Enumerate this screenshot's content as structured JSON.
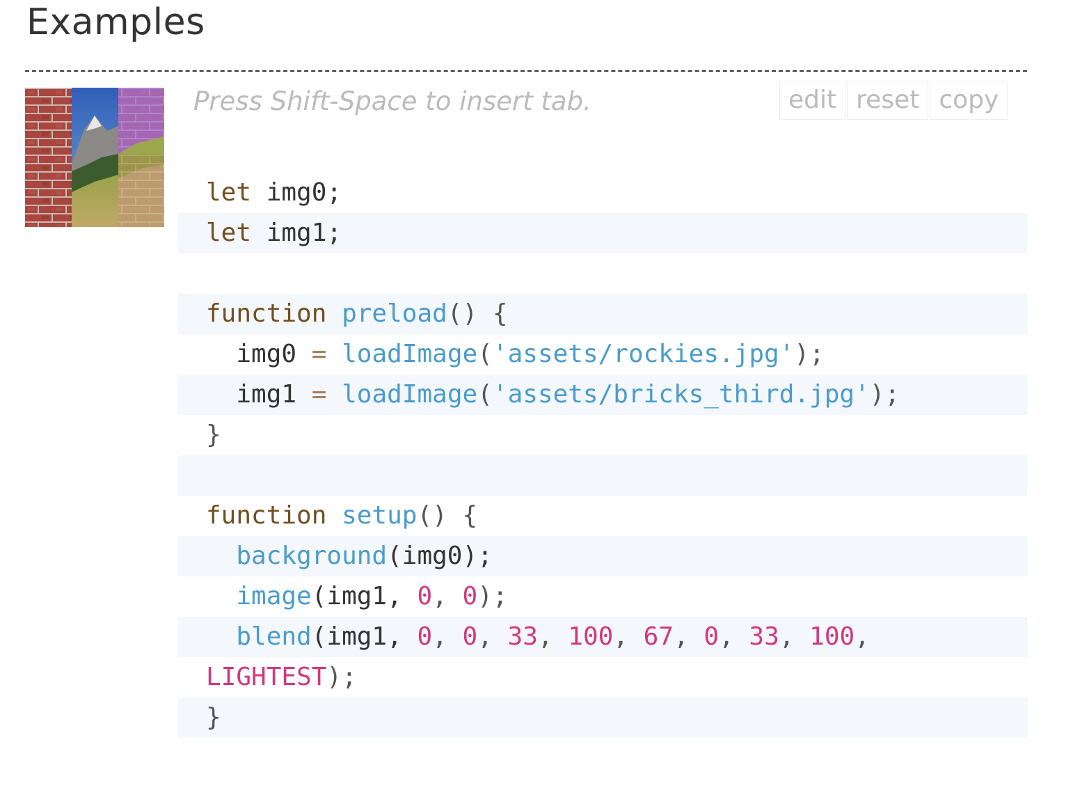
{
  "section": {
    "title": "Examples"
  },
  "editor": {
    "hint": "Press Shift-Space to insert tab.",
    "buttons": {
      "edit": "edit",
      "reset": "reset",
      "copy": "copy"
    }
  },
  "code": {
    "l1": {
      "kw": "let",
      "rest": " img0;"
    },
    "l2": {
      "kw": "let",
      "rest": " img1;"
    },
    "l4": {
      "kw": "function",
      "name": "preload",
      "rest": "() {"
    },
    "l5": {
      "indent": "  ",
      "var": "img0",
      "op": "=",
      "call": "loadImage",
      "open": "(",
      "str": "'assets/rockies.jpg'",
      "close": ");"
    },
    "l6": {
      "indent": "  ",
      "var": "img1",
      "op": "=",
      "call": "loadImage",
      "open": "(",
      "str": "'assets/bricks_third.jpg'",
      "close": ");"
    },
    "l7": {
      "text": "}"
    },
    "l9": {
      "kw": "function",
      "name": "setup",
      "rest": "() {"
    },
    "l10": {
      "call": "background",
      "args": "(img0);"
    },
    "l11": {
      "call": "image",
      "a1": "(img1, ",
      "n1": "0",
      "sep": ", ",
      "n2": "0",
      "end": ");"
    },
    "l12": {
      "call": "blend",
      "a1": "(img1, ",
      "nums": [
        "0",
        "0",
        "33",
        "100",
        "67",
        "0",
        "33",
        "100"
      ]
    },
    "l13": {
      "const": "LIGHTEST",
      "end": ");"
    },
    "l14": {
      "text": "}"
    }
  }
}
